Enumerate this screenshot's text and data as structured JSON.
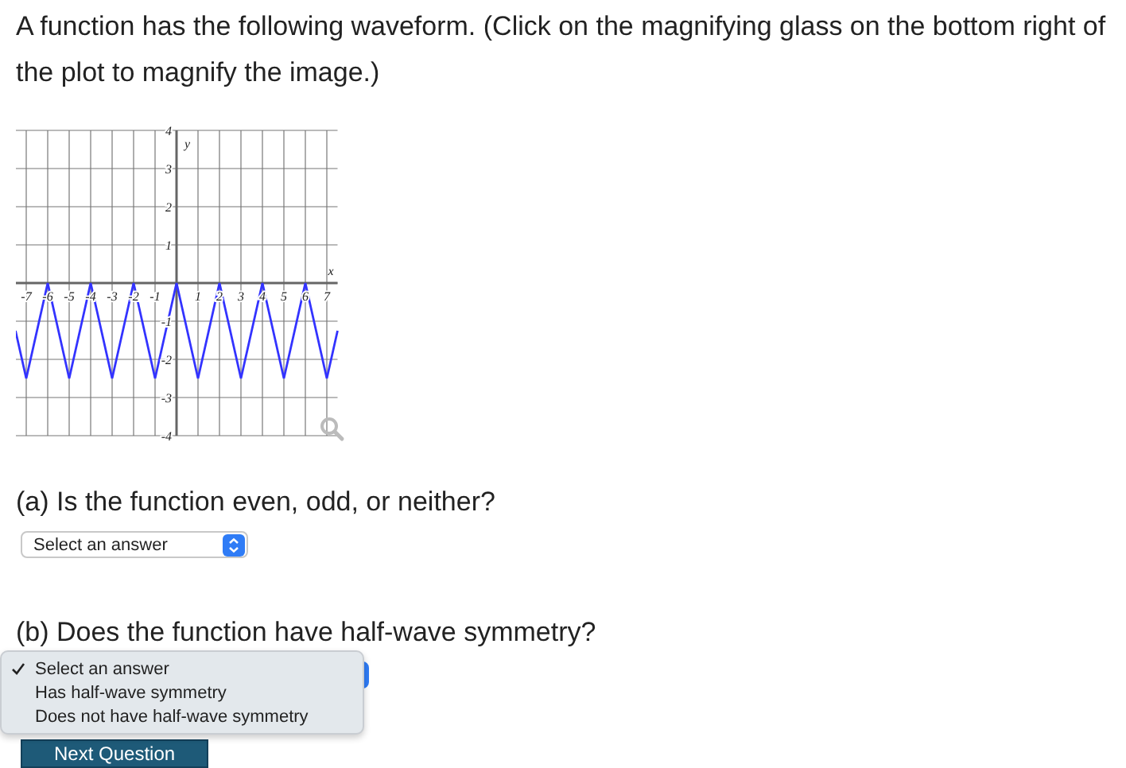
{
  "prompt": "A function has the following waveform. (Click on the magnifying glass on the bottom right of the plot to magnify the image.)",
  "chart_data": {
    "type": "line",
    "grid": true,
    "xlabel": "x",
    "ylabel": "y",
    "x": [
      -7.5,
      -7,
      -6,
      -5,
      -4,
      -3,
      -2,
      -1,
      0,
      1,
      2,
      3,
      4,
      5,
      6,
      7,
      7.5
    ],
    "series": [
      {
        "color": "#3333ff",
        "values": [
          -1.25,
          -2.5,
          0,
          -2.5,
          0,
          -2.5,
          0,
          -2.5,
          0,
          -2.5,
          0,
          -2.5,
          0,
          -2.5,
          0,
          -2.5,
          -1.25
        ]
      }
    ],
    "xlim": [
      -7.5,
      7.5
    ],
    "ylim": [
      -4,
      4
    ],
    "xticks": [
      -7,
      -6,
      -5,
      -4,
      -3,
      -2,
      -1,
      1,
      2,
      3,
      4,
      5,
      6,
      7
    ],
    "yticks": [
      -4,
      -3,
      -2,
      -1,
      1,
      2,
      3,
      4
    ]
  },
  "questions": [
    {
      "label": "(a) Is the function even, odd, or neither?",
      "select": {
        "open": false,
        "value": "Select an answer"
      }
    },
    {
      "label": "(b) Does the function have half-wave symmetry?",
      "select": {
        "open": true,
        "options": [
          {
            "label": "Select an answer",
            "selected": true
          },
          {
            "label": "Has half-wave symmetry",
            "selected": false
          },
          {
            "label": "Does not have half-wave symmetry",
            "selected": false
          }
        ]
      }
    }
  ],
  "button": "Next Question"
}
